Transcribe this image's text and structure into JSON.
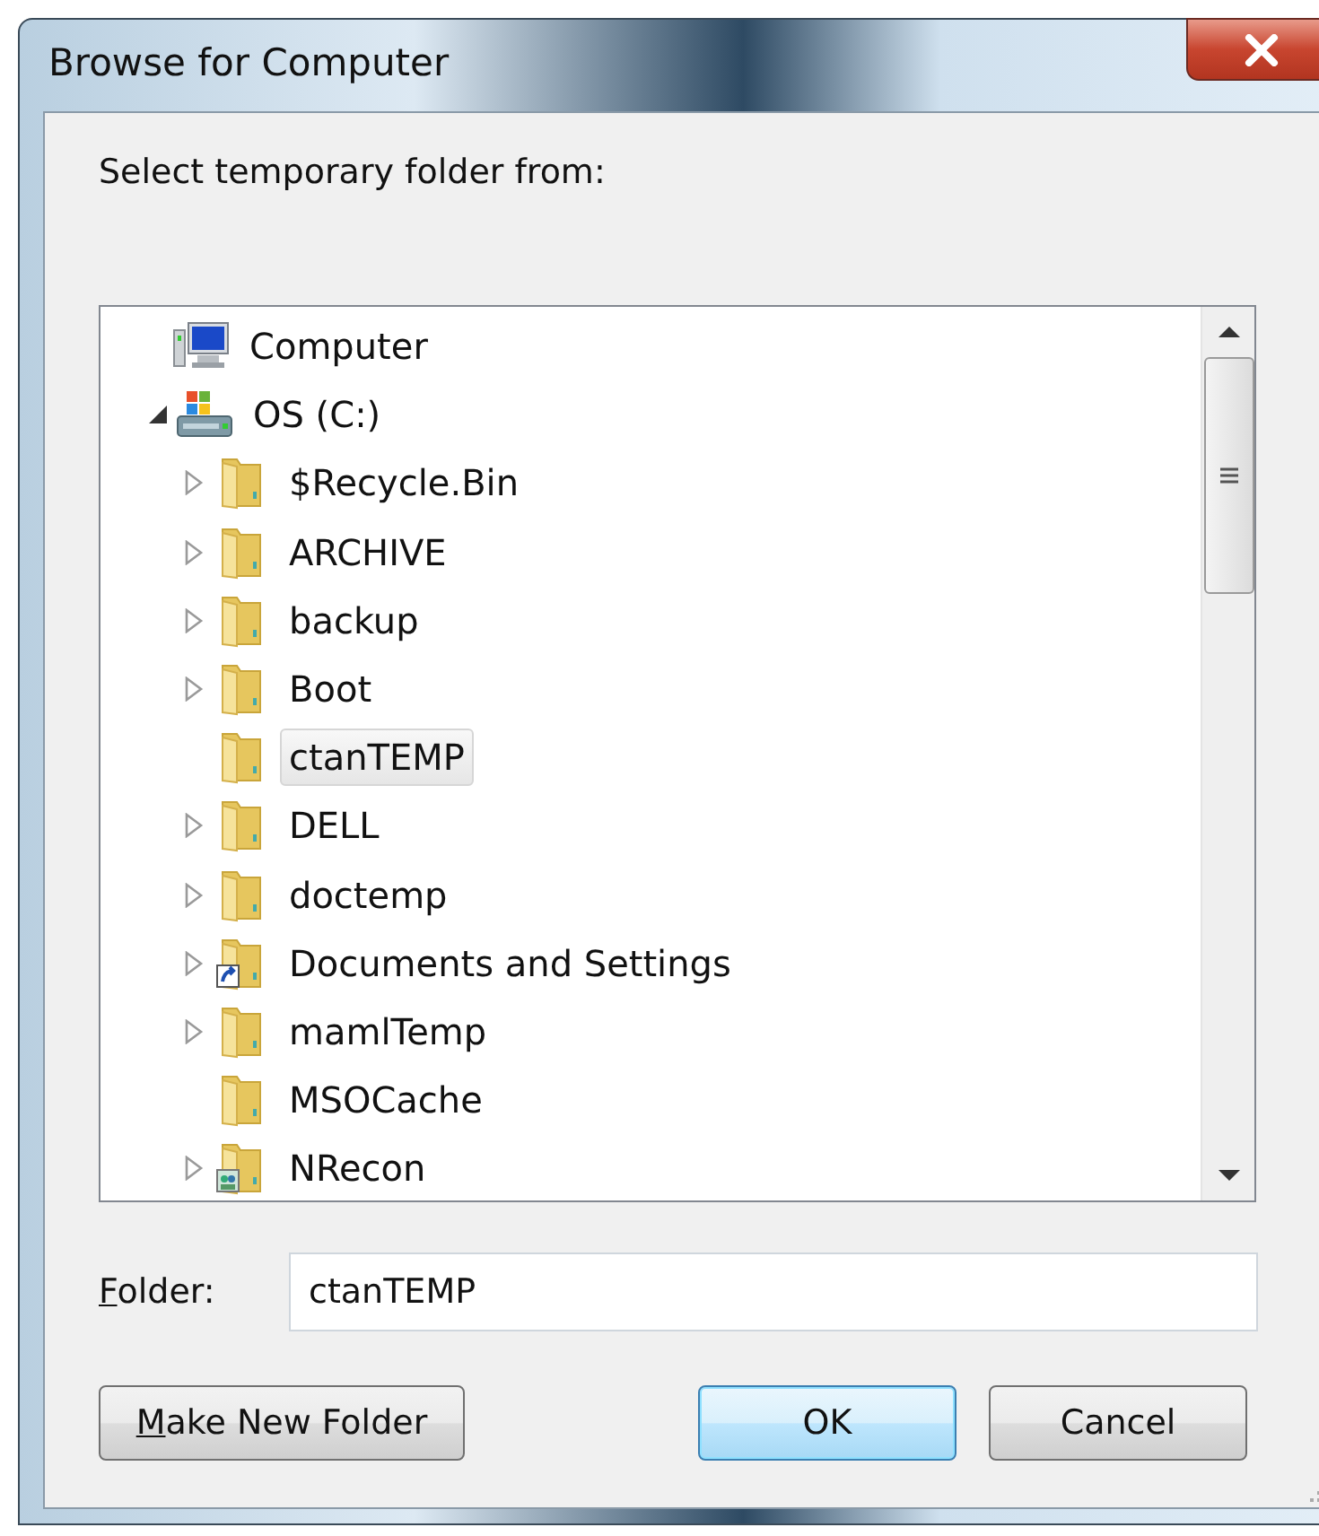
{
  "window": {
    "title": "Browse for Computer"
  },
  "prompt": "Select temporary folder from:",
  "tree": [
    {
      "label": "Computer",
      "kind": "computer",
      "expandable": false,
      "selected": false,
      "children": [
        {
          "label": "OS (C:)",
          "kind": "drive",
          "expandable": true,
          "expanded": true,
          "selected": false,
          "children": [
            {
              "label": "$Recycle.Bin",
              "kind": "folder",
              "expandable": true,
              "expanded": false,
              "selected": false
            },
            {
              "label": "ARCHIVE",
              "kind": "folder",
              "expandable": true,
              "expanded": false,
              "selected": false
            },
            {
              "label": "backup",
              "kind": "folder",
              "expandable": true,
              "expanded": false,
              "selected": false
            },
            {
              "label": "Boot",
              "kind": "folder",
              "expandable": true,
              "expanded": false,
              "selected": false
            },
            {
              "label": "ctanTEMP",
              "kind": "folder",
              "expandable": false,
              "selected": true
            },
            {
              "label": "DELL",
              "kind": "folder",
              "expandable": true,
              "expanded": false,
              "selected": false
            },
            {
              "label": "doctemp",
              "kind": "folder",
              "expandable": true,
              "expanded": false,
              "selected": false
            },
            {
              "label": "Documents and Settings",
              "kind": "shortcut",
              "expandable": true,
              "expanded": false,
              "selected": false
            },
            {
              "label": "mamlTemp",
              "kind": "folder",
              "expandable": true,
              "expanded": false,
              "selected": false
            },
            {
              "label": "MSOCache",
              "kind": "folder",
              "expandable": false,
              "selected": false
            },
            {
              "label": "NRecon",
              "kind": "special",
              "expandable": true,
              "expanded": false,
              "selected": false
            }
          ]
        }
      ]
    }
  ],
  "folder_field": {
    "label": "Folder:",
    "access_key": true,
    "value": "ctanTEMP"
  },
  "buttons": [
    {
      "label": "Make New Folder",
      "access_key": true,
      "default": false
    },
    {
      "label": "OK",
      "default": true
    },
    {
      "label": "Cancel",
      "default": false
    }
  ]
}
